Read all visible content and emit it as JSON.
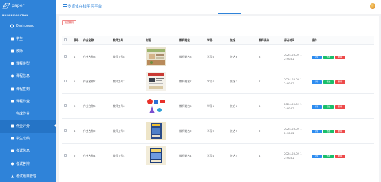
{
  "brand": {
    "logo_text": "paper"
  },
  "sidebar": {
    "heading": "MAIN NAVIGATION",
    "items": [
      {
        "label": "Dashboard",
        "icon": "circle-icon"
      },
      {
        "label": "学生",
        "icon": "grid-icon"
      },
      {
        "label": "教师",
        "icon": "grid-icon"
      },
      {
        "label": "课程类型",
        "icon": "circle-icon"
      },
      {
        "label": "课程信息",
        "icon": "circle-icon"
      },
      {
        "label": "课程签到",
        "icon": "grid-icon"
      },
      {
        "label": "课程作业",
        "icon": "grid-icon"
      },
      {
        "label": "完成作业",
        "icon": "circle-icon"
      },
      {
        "label": "作业评分",
        "icon": "grid-icon"
      },
      {
        "label": "学生成绩",
        "icon": "grid-icon"
      },
      {
        "label": "考试信息",
        "icon": "grid-icon"
      },
      {
        "label": "考试答辩",
        "icon": "circle-icon"
      },
      {
        "label": "考试题目管理",
        "icon": "triangle-icon"
      }
    ],
    "active_index": 8
  },
  "header": {
    "title": "多媒体在线学习平台"
  },
  "toolbar": {
    "batch_delete_label": "批量删除"
  },
  "table": {
    "columns": [
      "序号",
      "作业名称",
      "教师工号",
      "封面",
      "教师姓名",
      "学号",
      "姓名",
      "教师评分",
      "评分时间",
      "操作"
    ],
    "rows": [
      {
        "index": "1",
        "name": "作业名称8",
        "teacher_id": "教师工号8",
        "teacher_name": "教师姓名8",
        "student_id": "学号8",
        "student_name": "姓名8",
        "score": "8",
        "time_line1": "2024-03-02 1",
        "time_line2": "2:20:02"
      },
      {
        "index": "2",
        "name": "作业名称7",
        "teacher_id": "教师工号7",
        "teacher_name": "教师姓名7",
        "student_id": "学号7",
        "student_name": "姓名7",
        "score": "7",
        "time_line1": "2024-03-02 1",
        "time_line2": "2:20:02"
      },
      {
        "index": "3",
        "name": "作业名称6",
        "teacher_id": "教师工号6",
        "teacher_name": "教师姓名6",
        "student_id": "学号6",
        "student_name": "姓名6",
        "score": "6",
        "time_line1": "2024-03-02 1",
        "time_line2": "2:20:02"
      },
      {
        "index": "4",
        "name": "作业名称5",
        "teacher_id": "教师工号5",
        "teacher_name": "教师姓名5",
        "student_id": "学号5",
        "student_name": "姓名5",
        "score": "5",
        "time_line1": "2024-03-02 1",
        "time_line2": "2:20:02"
      },
      {
        "index": "5",
        "name": "作业名称4",
        "teacher_id": "教师工号4",
        "teacher_name": "教师姓名4",
        "student_id": "学号4",
        "student_name": "姓名4",
        "score": "4",
        "time_line1": "2024-03-02 1",
        "time_line2": "2:20:02"
      }
    ],
    "actions": {
      "detail": "详情",
      "edit": "修改",
      "delete": "删除"
    }
  },
  "colors": {
    "sidebar": "#2f83d9",
    "sidebar_active": "#2574c6",
    "detail": "#2d8cf0",
    "edit": "#19be6b",
    "delete": "#ed4a4a"
  }
}
